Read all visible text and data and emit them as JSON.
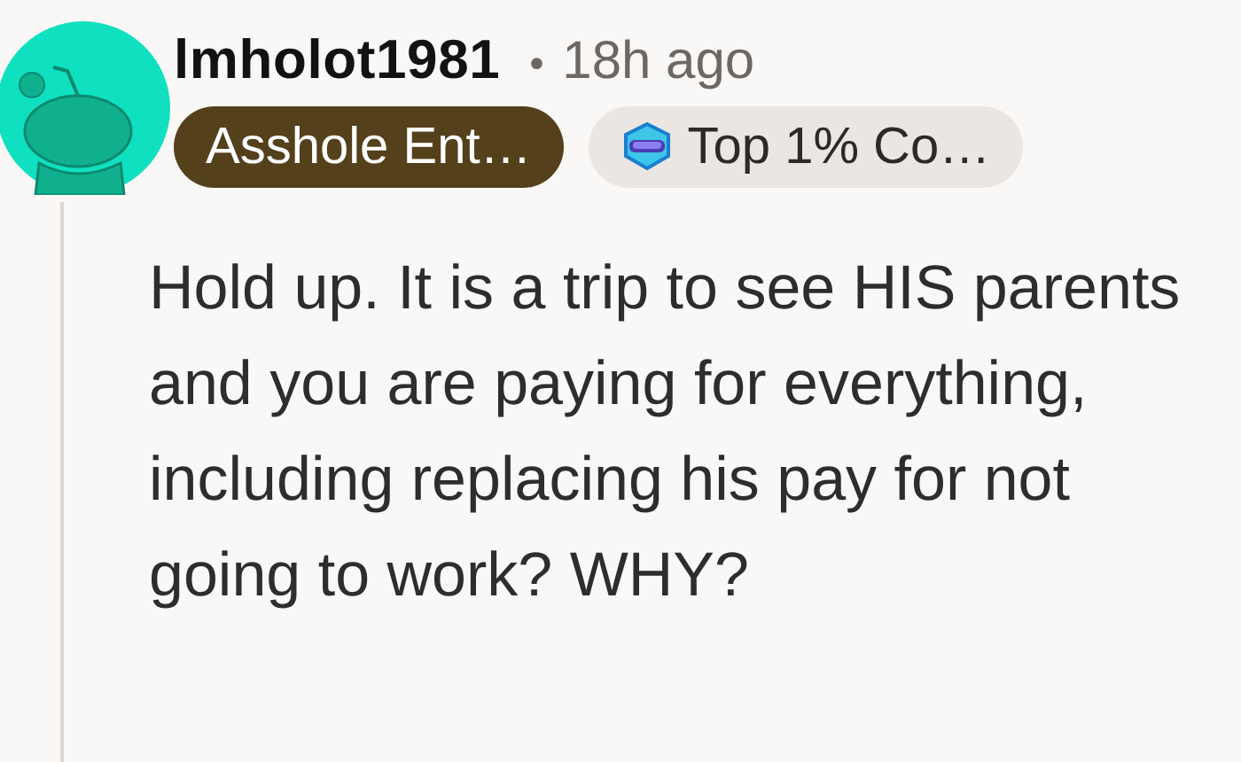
{
  "comment": {
    "author": "lmholot1981",
    "separator": "•",
    "time": "18h ago",
    "flairs": [
      {
        "kind": "user",
        "label": "Asshole Ent…"
      },
      {
        "kind": "achievement",
        "label": "Top 1% Co…"
      }
    ],
    "body": "Hold up. It is a trip to see HIS parents and you are paying for everything, including replacing his pay for not going to work? WHY?"
  }
}
